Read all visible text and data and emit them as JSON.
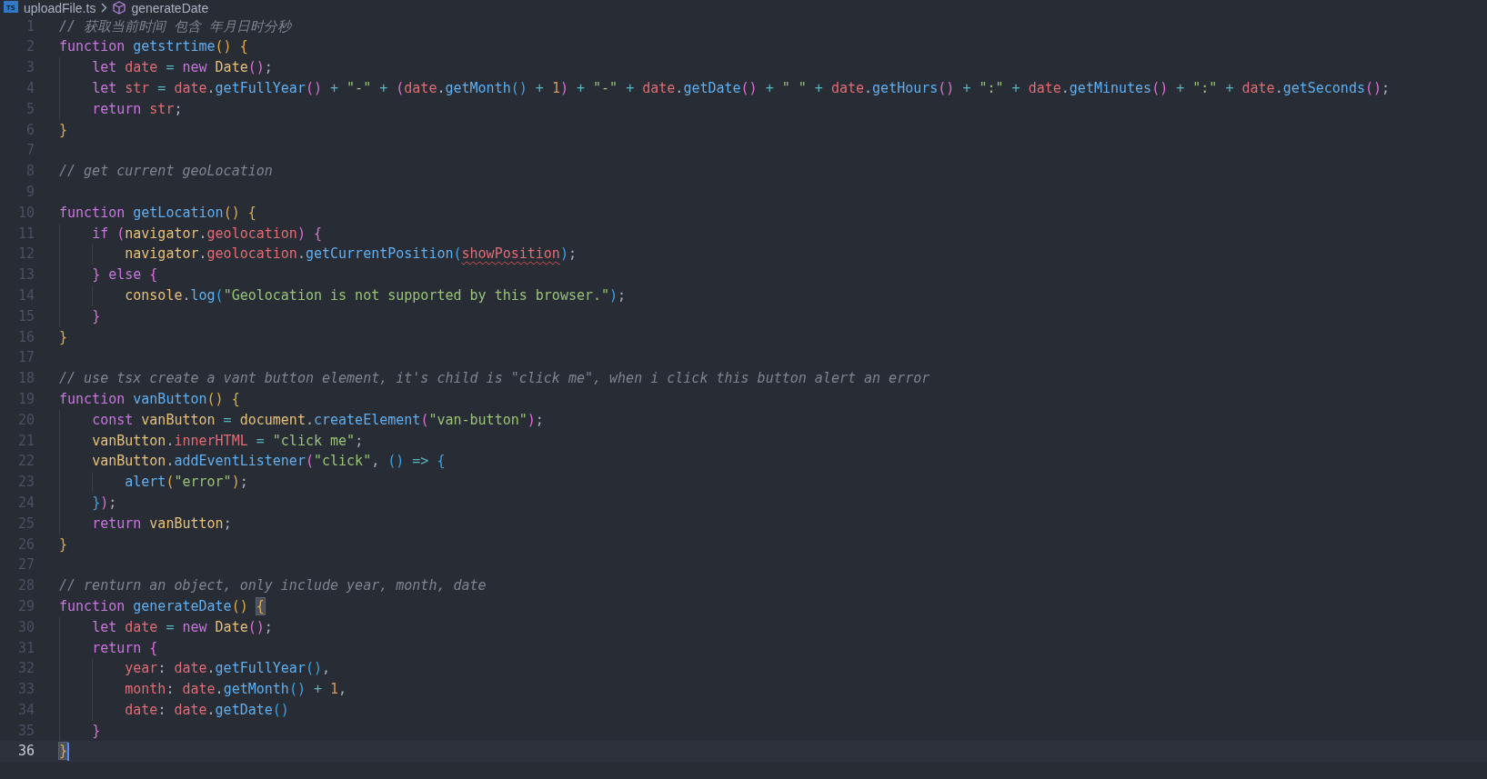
{
  "breadcrumb": {
    "file_badge": "TS",
    "file": "uploadFile.ts",
    "symbol": "generateDate"
  },
  "lines": [
    {
      "number": "1",
      "current": false,
      "tokens": [
        {
          "kind": "cmt",
          "text": "// 获取当前时间 包含 年月日时分秒"
        }
      ]
    },
    {
      "number": "2",
      "current": false,
      "tokens": [
        {
          "kind": "kw",
          "text": "function "
        },
        {
          "kind": "fn",
          "text": "getstrtime"
        },
        {
          "kind": "b1",
          "text": "() "
        },
        {
          "kind": "b1",
          "text": "{"
        }
      ]
    },
    {
      "number": "3",
      "current": false,
      "tokens": [
        {
          "kind": "kw",
          "text": "    let "
        },
        {
          "kind": "var",
          "text": "date"
        },
        {
          "kind": "op",
          "text": " = "
        },
        {
          "kind": "kw",
          "text": "new "
        },
        {
          "kind": "obj",
          "text": "Date"
        },
        {
          "kind": "b2",
          "text": "()"
        },
        {
          "kind": "plain",
          "text": ";"
        }
      ]
    },
    {
      "number": "4",
      "current": false,
      "tokens": [
        {
          "kind": "kw",
          "text": "    let "
        },
        {
          "kind": "var",
          "text": "str"
        },
        {
          "kind": "op",
          "text": " = "
        },
        {
          "kind": "var",
          "text": "date"
        },
        {
          "kind": "plain",
          "text": "."
        },
        {
          "kind": "fn",
          "text": "getFullYear"
        },
        {
          "kind": "b2",
          "text": "()"
        },
        {
          "kind": "op",
          "text": " + "
        },
        {
          "kind": "str",
          "text": "\"-\""
        },
        {
          "kind": "op",
          "text": " + "
        },
        {
          "kind": "b2",
          "text": "("
        },
        {
          "kind": "var",
          "text": "date"
        },
        {
          "kind": "plain",
          "text": "."
        },
        {
          "kind": "fn",
          "text": "getMonth"
        },
        {
          "kind": "b3",
          "text": "()"
        },
        {
          "kind": "op",
          "text": " + "
        },
        {
          "kind": "num",
          "text": "1"
        },
        {
          "kind": "b2",
          "text": ")"
        },
        {
          "kind": "op",
          "text": " + "
        },
        {
          "kind": "str",
          "text": "\"-\""
        },
        {
          "kind": "op",
          "text": " + "
        },
        {
          "kind": "var",
          "text": "date"
        },
        {
          "kind": "plain",
          "text": "."
        },
        {
          "kind": "fn",
          "text": "getDate"
        },
        {
          "kind": "b2",
          "text": "()"
        },
        {
          "kind": "op",
          "text": " + "
        },
        {
          "kind": "str",
          "text": "\" \""
        },
        {
          "kind": "op",
          "text": " + "
        },
        {
          "kind": "var",
          "text": "date"
        },
        {
          "kind": "plain",
          "text": "."
        },
        {
          "kind": "fn",
          "text": "getHours"
        },
        {
          "kind": "b2",
          "text": "()"
        },
        {
          "kind": "op",
          "text": " + "
        },
        {
          "kind": "str",
          "text": "\":\""
        },
        {
          "kind": "op",
          "text": " + "
        },
        {
          "kind": "var",
          "text": "date"
        },
        {
          "kind": "plain",
          "text": "."
        },
        {
          "kind": "fn",
          "text": "getMinutes"
        },
        {
          "kind": "b2",
          "text": "()"
        },
        {
          "kind": "op",
          "text": " + "
        },
        {
          "kind": "str",
          "text": "\":\""
        },
        {
          "kind": "op",
          "text": " + "
        },
        {
          "kind": "var",
          "text": "date"
        },
        {
          "kind": "plain",
          "text": "."
        },
        {
          "kind": "fn",
          "text": "getSeconds"
        },
        {
          "kind": "b2",
          "text": "()"
        },
        {
          "kind": "plain",
          "text": ";"
        }
      ]
    },
    {
      "number": "5",
      "current": false,
      "tokens": [
        {
          "kind": "kw",
          "text": "    return "
        },
        {
          "kind": "var",
          "text": "str"
        },
        {
          "kind": "plain",
          "text": ";"
        }
      ]
    },
    {
      "number": "6",
      "current": false,
      "tokens": [
        {
          "kind": "b1",
          "text": "}"
        }
      ]
    },
    {
      "number": "7",
      "current": false
    },
    {
      "number": "8",
      "current": false,
      "tokens": [
        {
          "kind": "cmt",
          "text": "// get current geoLocation"
        }
      ]
    },
    {
      "number": "9",
      "current": false
    },
    {
      "number": "10",
      "current": false,
      "tokens": [
        {
          "kind": "kw",
          "text": "function "
        },
        {
          "kind": "fn",
          "text": "getLocation"
        },
        {
          "kind": "b1",
          "text": "() "
        },
        {
          "kind": "b1",
          "text": "{"
        }
      ]
    },
    {
      "number": "11",
      "current": false,
      "tokens": [
        {
          "kind": "kw",
          "text": "    if "
        },
        {
          "kind": "b2",
          "text": "("
        },
        {
          "kind": "obj",
          "text": "navigator"
        },
        {
          "kind": "plain",
          "text": "."
        },
        {
          "kind": "var",
          "text": "geolocation"
        },
        {
          "kind": "b2",
          "text": ") "
        },
        {
          "kind": "b2",
          "text": "{"
        }
      ]
    },
    {
      "number": "12",
      "current": false,
      "tokens": [
        {
          "kind": "obj",
          "text": "        navigator"
        },
        {
          "kind": "plain",
          "text": "."
        },
        {
          "kind": "var",
          "text": "geolocation"
        },
        {
          "kind": "plain",
          "text": "."
        },
        {
          "kind": "fn",
          "text": "getCurrentPosition"
        },
        {
          "kind": "b3",
          "text": "("
        },
        {
          "kind": "error",
          "text": "showPosition"
        },
        {
          "kind": "b3",
          "text": ")"
        },
        {
          "kind": "plain",
          "text": ";"
        }
      ]
    },
    {
      "number": "13",
      "current": false,
      "tokens": [
        {
          "kind": "b2",
          "text": "    } "
        },
        {
          "kind": "kw",
          "text": "else "
        },
        {
          "kind": "b2",
          "text": "{"
        }
      ]
    },
    {
      "number": "14",
      "current": false,
      "tokens": [
        {
          "kind": "obj",
          "text": "        console"
        },
        {
          "kind": "plain",
          "text": "."
        },
        {
          "kind": "fn",
          "text": "log"
        },
        {
          "kind": "b3",
          "text": "("
        },
        {
          "kind": "str",
          "text": "\"Geolocation is not supported by this browser.\""
        },
        {
          "kind": "b3",
          "text": ")"
        },
        {
          "kind": "plain",
          "text": ";"
        }
      ]
    },
    {
      "number": "15",
      "current": false,
      "tokens": [
        {
          "kind": "b2",
          "text": "    }"
        }
      ]
    },
    {
      "number": "16",
      "current": false,
      "tokens": [
        {
          "kind": "b1",
          "text": "}"
        }
      ]
    },
    {
      "number": "17",
      "current": false
    },
    {
      "number": "18",
      "current": false,
      "tokens": [
        {
          "kind": "cmt",
          "text": "// use tsx create a vant button element, it's child is \"click me\", when i click this button alert an error"
        }
      ]
    },
    {
      "number": "19",
      "current": false,
      "tokens": [
        {
          "kind": "kw",
          "text": "function "
        },
        {
          "kind": "fn",
          "text": "vanButton"
        },
        {
          "kind": "b1",
          "text": "() "
        },
        {
          "kind": "b1",
          "text": "{"
        }
      ]
    },
    {
      "number": "20",
      "current": false,
      "tokens": [
        {
          "kind": "kw",
          "text": "    const "
        },
        {
          "kind": "obj",
          "text": "vanButton"
        },
        {
          "kind": "op",
          "text": " = "
        },
        {
          "kind": "obj",
          "text": "document"
        },
        {
          "kind": "plain",
          "text": "."
        },
        {
          "kind": "fn",
          "text": "createElement"
        },
        {
          "kind": "b2",
          "text": "("
        },
        {
          "kind": "str",
          "text": "\"van-button\""
        },
        {
          "kind": "b2",
          "text": ")"
        },
        {
          "kind": "plain",
          "text": ";"
        }
      ]
    },
    {
      "number": "21",
      "current": false,
      "tokens": [
        {
          "kind": "obj",
          "text": "    vanButton"
        },
        {
          "kind": "plain",
          "text": "."
        },
        {
          "kind": "var",
          "text": "innerHTML"
        },
        {
          "kind": "op",
          "text": " = "
        },
        {
          "kind": "str",
          "text": "\"click me\""
        },
        {
          "kind": "plain",
          "text": ";"
        }
      ]
    },
    {
      "number": "22",
      "current": false,
      "tokens": [
        {
          "kind": "obj",
          "text": "    vanButton"
        },
        {
          "kind": "plain",
          "text": "."
        },
        {
          "kind": "fn",
          "text": "addEventListener"
        },
        {
          "kind": "b2",
          "text": "("
        },
        {
          "kind": "str",
          "text": "\"click\""
        },
        {
          "kind": "plain",
          "text": ", "
        },
        {
          "kind": "b3",
          "text": "()"
        },
        {
          "kind": "op",
          "text": " => "
        },
        {
          "kind": "b3",
          "text": "{"
        }
      ]
    },
    {
      "number": "23",
      "current": false,
      "tokens": [
        {
          "kind": "fn",
          "text": "        alert"
        },
        {
          "kind": "b1",
          "text": "("
        },
        {
          "kind": "str",
          "text": "\"error\""
        },
        {
          "kind": "b1",
          "text": ")"
        },
        {
          "kind": "plain",
          "text": ";"
        }
      ]
    },
    {
      "number": "24",
      "current": false,
      "tokens": [
        {
          "kind": "b3",
          "text": "    }"
        },
        {
          "kind": "b2",
          "text": ")"
        },
        {
          "kind": "plain",
          "text": ";"
        }
      ]
    },
    {
      "number": "25",
      "current": false,
      "tokens": [
        {
          "kind": "kw",
          "text": "    return "
        },
        {
          "kind": "obj",
          "text": "vanButton"
        },
        {
          "kind": "plain",
          "text": ";"
        }
      ]
    },
    {
      "number": "26",
      "current": false,
      "tokens": [
        {
          "kind": "b1",
          "text": "}"
        }
      ]
    },
    {
      "number": "27",
      "current": false
    },
    {
      "number": "28",
      "current": false,
      "tokens": [
        {
          "kind": "cmt",
          "text": "// renturn an object, only include year, month, date"
        }
      ]
    },
    {
      "number": "29",
      "current": false,
      "tokens": [
        {
          "kind": "kw",
          "text": "function "
        },
        {
          "kind": "fn",
          "text": "generateDate"
        },
        {
          "kind": "b1",
          "text": "() "
        },
        {
          "kind": "match",
          "text": "{"
        }
      ]
    },
    {
      "number": "30",
      "current": false,
      "tokens": [
        {
          "kind": "kw",
          "text": "    let "
        },
        {
          "kind": "var",
          "text": "date"
        },
        {
          "kind": "op",
          "text": " = "
        },
        {
          "kind": "kw",
          "text": "new "
        },
        {
          "kind": "obj",
          "text": "Date"
        },
        {
          "kind": "b2",
          "text": "()"
        },
        {
          "kind": "plain",
          "text": ";"
        }
      ]
    },
    {
      "number": "31",
      "current": false,
      "tokens": [
        {
          "kind": "kw",
          "text": "    return "
        },
        {
          "kind": "b2",
          "text": "{"
        }
      ]
    },
    {
      "number": "32",
      "current": false,
      "tokens": [
        {
          "kind": "var",
          "text": "        year"
        },
        {
          "kind": "plain",
          "text": ": "
        },
        {
          "kind": "var",
          "text": "date"
        },
        {
          "kind": "plain",
          "text": "."
        },
        {
          "kind": "fn",
          "text": "getFullYear"
        },
        {
          "kind": "b3",
          "text": "()"
        },
        {
          "kind": "plain",
          "text": ","
        }
      ]
    },
    {
      "number": "33",
      "current": false,
      "tokens": [
        {
          "kind": "var",
          "text": "        month"
        },
        {
          "kind": "plain",
          "text": ": "
        },
        {
          "kind": "var",
          "text": "date"
        },
        {
          "kind": "plain",
          "text": "."
        },
        {
          "kind": "fn",
          "text": "getMonth"
        },
        {
          "kind": "b3",
          "text": "()"
        },
        {
          "kind": "op",
          "text": " + "
        },
        {
          "kind": "num",
          "text": "1"
        },
        {
          "kind": "plain",
          "text": ","
        }
      ]
    },
    {
      "number": "34",
      "current": false,
      "tokens": [
        {
          "kind": "var",
          "text": "        date"
        },
        {
          "kind": "plain",
          "text": ": "
        },
        {
          "kind": "var",
          "text": "date"
        },
        {
          "kind": "plain",
          "text": "."
        },
        {
          "kind": "fn",
          "text": "getDate"
        },
        {
          "kind": "b3",
          "text": "()"
        }
      ]
    },
    {
      "number": "35",
      "current": false,
      "tokens": [
        {
          "kind": "b2",
          "text": "    }"
        }
      ]
    },
    {
      "number": "36",
      "current": true,
      "tokens": [
        {
          "kind": "match",
          "text": "}"
        }
      ]
    }
  ]
}
